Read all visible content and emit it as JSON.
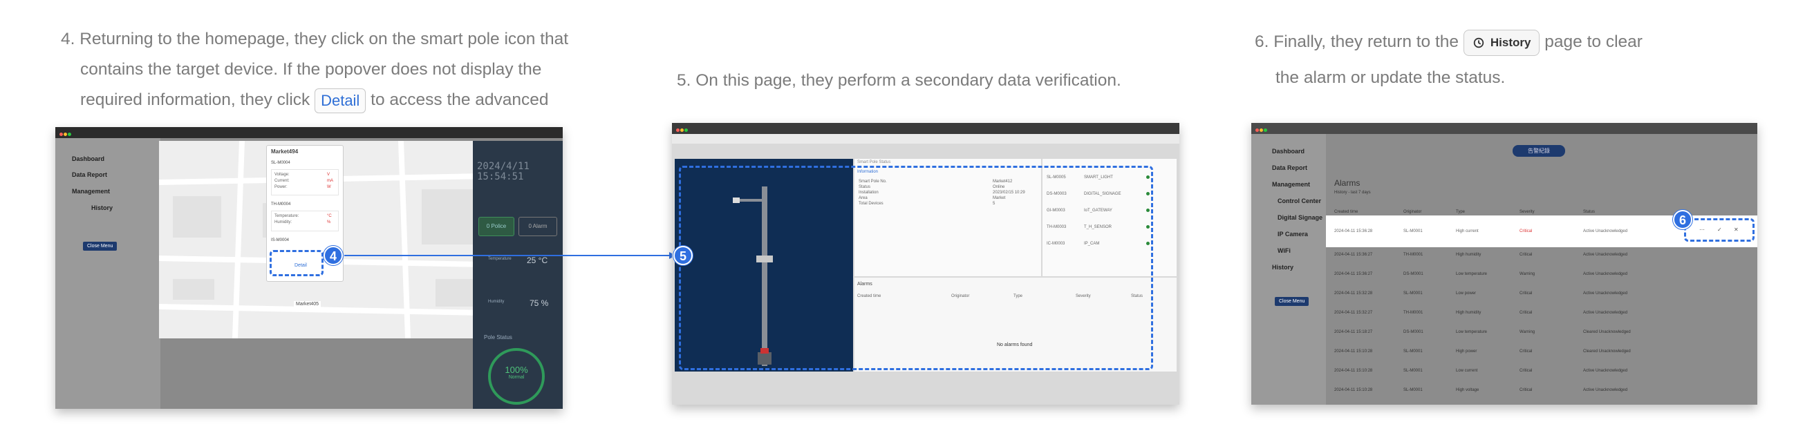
{
  "steps": {
    "s4": {
      "line1": "4. Returning to the homepage, they click on the smart pole icon that",
      "line2": "contains the target device. If the popover does not display the",
      "line3a": "required information, they click",
      "button": "Detail",
      "line3b": "to access the advanced"
    },
    "s5": {
      "text": "5. On this page, they perform a secondary data verification."
    },
    "s6": {
      "line1a": "6. Finally, they return to the",
      "button": "History",
      "line1b": "page to clear",
      "line2": "the alarm or update the status."
    }
  },
  "shot4": {
    "sidebar": [
      "Dashboard",
      "Data Report",
      "Management",
      "History"
    ],
    "close_menu": "Close Menu",
    "popover_title": "Market494",
    "dev1": "SL-M0004",
    "dev1_fields": [
      "Voltage:",
      "Current:",
      "Power:"
    ],
    "dev1_values": [
      "V",
      "mA",
      "W"
    ],
    "dev2": "TH-M0004",
    "dev2_fields": [
      "Temperature:",
      "Humidity:"
    ],
    "dev2_values": [
      "°C",
      "%"
    ],
    "dev3": "IS-M0004",
    "detail": "Detail",
    "marker": "Market405",
    "date": "2024/4/11",
    "time": "15:54:51",
    "police": "0 Police",
    "alarm": "0 Alarm",
    "temp_label": "Temperature",
    "temp": "25 °C",
    "hum_label": "Humidity",
    "hum": "75 %",
    "pole_status": "Pole Status",
    "gauge": "100%",
    "gauge_label": "Normal",
    "badge": "4"
  },
  "shot5": {
    "panel_title": "Smart Pole Status",
    "info_label": "Information",
    "info_keys": [
      "Smart Pole No.",
      "Status",
      "Installation",
      "Area",
      "Total Devices"
    ],
    "info_vals": [
      "Market412",
      "Online",
      "2023/02/15 10:29",
      "Market",
      "5"
    ],
    "devices": [
      [
        "SL-M0005",
        "SMART_LIGHT"
      ],
      [
        "DS-M0003",
        "DIGITAL_SIGNAGE"
      ],
      [
        "GI-M0003",
        "IoT_GATEWAY"
      ],
      [
        "TH-M0003",
        "T_H_SENSOR"
      ],
      [
        "IC-M0003",
        "IP_CAM"
      ]
    ],
    "alarms_title": "Alarms",
    "alarm_cols": [
      "Created time",
      "Originator",
      "Type",
      "Severity",
      "Status"
    ],
    "no_alarms": "No alarms found",
    "badge": "5"
  },
  "shot6": {
    "sidebar": [
      "Dashboard",
      "Data Report",
      "Management",
      "Control Center",
      "Digital Signage",
      "IP Camera",
      "WiFi",
      "History"
    ],
    "close_menu": "Close Menu",
    "top_button": "告警紀錄",
    "title": "Alarms",
    "filter": "History - last 7 days",
    "cols": [
      "Created time",
      "Originator",
      "Type",
      "Severity",
      "Status"
    ],
    "rows": [
      [
        "2024-04-11 15:36:28",
        "SL-M0001",
        "High current",
        "Critical",
        "Active Unacknowledged"
      ],
      [
        "2024-04-11 15:36:27",
        "TH-M0001",
        "High humidity",
        "Critical",
        "Active Unacknowledged"
      ],
      [
        "2024-04-11 15:36:27",
        "DS-M0001",
        "Low temperature",
        "Warning",
        "Active Unacknowledged"
      ],
      [
        "2024-04-11 15:32:28",
        "SL-M0001",
        "Low power",
        "Critical",
        "Active Unacknowledged"
      ],
      [
        "2024-04-11 15:32:27",
        "TH-M0001",
        "High humidity",
        "Critical",
        "Active Unacknowledged"
      ],
      [
        "2024-04-11 15:18:27",
        "DS-M0001",
        "Low temperature",
        "Warning",
        "Cleared Unacknowledged"
      ],
      [
        "2024-04-11 15:10:28",
        "SL-M0001",
        "High power",
        "Critical",
        "Cleared Unacknowledged"
      ],
      [
        "2024-04-11 15:10:28",
        "SL-M0001",
        "Low current",
        "Critical",
        "Active Unacknowledged"
      ],
      [
        "2024-04-11 15:10:28",
        "SL-M0001",
        "High voltage",
        "Critical",
        "Active Unacknowledged"
      ]
    ],
    "badge": "6"
  }
}
